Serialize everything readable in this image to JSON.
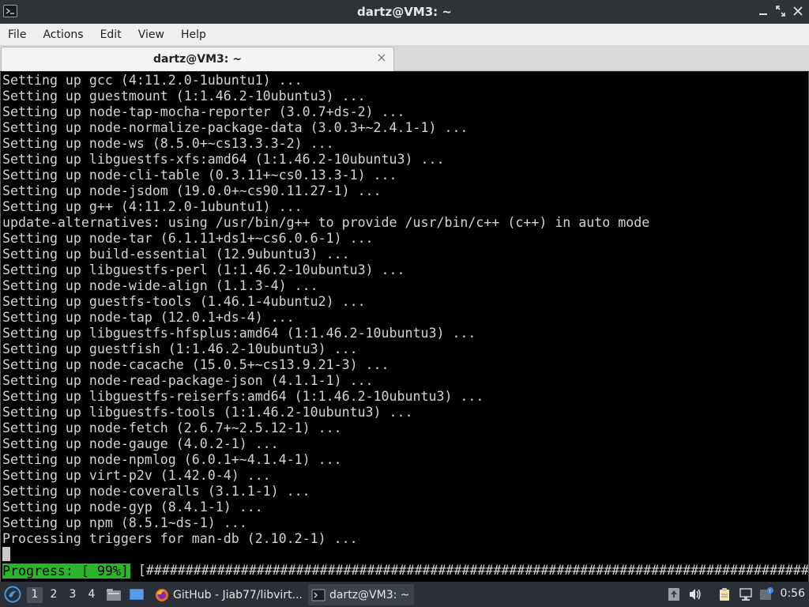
{
  "window": {
    "title": "dartz@VM3: ~"
  },
  "menu": {
    "items": [
      "File",
      "Actions",
      "Edit",
      "View",
      "Help"
    ]
  },
  "tabs": [
    {
      "label": "dartz@VM3: ~"
    }
  ],
  "terminal": {
    "lines": [
      "Setting up gcc (4:11.2.0-1ubuntu1) ...",
      "Setting up guestmount (1:1.46.2-10ubuntu3) ...",
      "Setting up node-tap-mocha-reporter (3.0.7+ds-2) ...",
      "Setting up node-normalize-package-data (3.0.3+~2.4.1-1) ...",
      "Setting up node-ws (8.5.0+~cs13.3.3-2) ...",
      "Setting up libguestfs-xfs:amd64 (1:1.46.2-10ubuntu3) ...",
      "Setting up node-cli-table (0.3.11+~cs0.13.3-1) ...",
      "Setting up node-jsdom (19.0.0+~cs90.11.27-1) ...",
      "Setting up g++ (4:11.2.0-1ubuntu1) ...",
      "update-alternatives: using /usr/bin/g++ to provide /usr/bin/c++ (c++) in auto mode",
      "Setting up node-tar (6.1.11+ds1+~cs6.0.6-1) ...",
      "Setting up build-essential (12.9ubuntu3) ...",
      "Setting up libguestfs-perl (1:1.46.2-10ubuntu3) ...",
      "Setting up node-wide-align (1.1.3-4) ...",
      "Setting up guestfs-tools (1.46.1-4ubuntu2) ...",
      "Setting up node-tap (12.0.1+ds-4) ...",
      "Setting up libguestfs-hfsplus:amd64 (1:1.46.2-10ubuntu3) ...",
      "Setting up guestfish (1:1.46.2-10ubuntu3) ...",
      "Setting up node-cacache (15.0.5+~cs13.9.21-3) ...",
      "Setting up node-read-package-json (4.1.1-1) ...",
      "Setting up libguestfs-reiserfs:amd64 (1:1.46.2-10ubuntu3) ...",
      "Setting up libguestfs-tools (1:1.46.2-10ubuntu3) ...",
      "Setting up node-fetch (2.6.7+~2.5.12-1) ...",
      "Setting up node-gauge (4.0.2-1) ...",
      "Setting up node-npmlog (6.0.1+~4.1.4-1) ...",
      "Setting up virt-p2v (1.42.0-4) ...",
      "Setting up node-coveralls (3.1.1-1) ...",
      "Setting up node-gyp (8.4.1-1) ...",
      "Setting up npm (8.5.1~ds-1) ...",
      "Processing triggers for man-db (2.10.2-1) ..."
    ],
    "progress_label": "Progress: [ 99%]",
    "progress_bar": "[#######################################################################################.]",
    "progress_percent": 99
  },
  "taskbar": {
    "workspaces": [
      "1",
      "2",
      "3",
      "4"
    ],
    "active_workspace": "1",
    "tasks": [
      {
        "label": "GitHub - Jiab77/libvirt..."
      },
      {
        "label": "dartz@VM3: ~"
      }
    ],
    "clock": "0:56"
  },
  "colors": {
    "terminal_bg": "#000000",
    "terminal_fg": "#d3d3d3",
    "progress_green": "#2bb52b",
    "titlebar_bg": "#2e3338",
    "taskbar_bg": "#2b3036"
  }
}
